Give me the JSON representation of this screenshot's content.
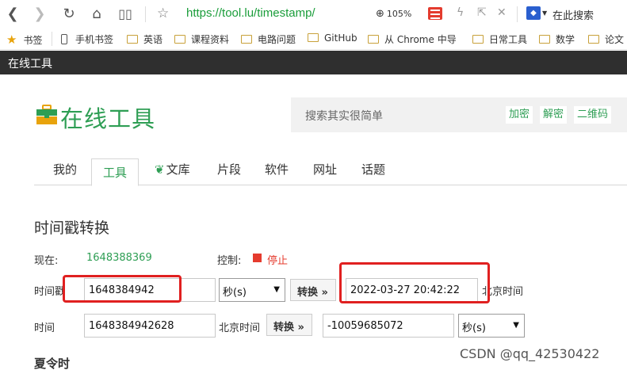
{
  "browser": {
    "url_scheme": "https://",
    "url_rest": "tool.lu/timestamp/",
    "zoom": "105%",
    "search_here": "在此搜索"
  },
  "bookmarks": [
    {
      "label": "书签",
      "icon": "star-icon"
    },
    {
      "label": "手机书签",
      "icon": "phone-icon"
    },
    {
      "label": "英语",
      "icon": "folder-icon"
    },
    {
      "label": "课程资料",
      "icon": "folder-icon"
    },
    {
      "label": "电路问题",
      "icon": "folder-icon"
    },
    {
      "label": "GitHub",
      "icon": "folder-icon"
    },
    {
      "label": "从 Chrome 中导",
      "icon": "folder-icon"
    },
    {
      "label": "日常工具",
      "icon": "folder-icon"
    },
    {
      "label": "数学",
      "icon": "folder-icon"
    },
    {
      "label": "论文",
      "icon": "folder-icon"
    }
  ],
  "sitebar_title": "在线工具",
  "logo_text": "在线工具",
  "search": {
    "placeholder": "搜索其实很简单",
    "buttons": [
      "加密",
      "解密",
      "二维码"
    ]
  },
  "tabs": [
    "我的",
    "工具",
    "文库",
    "片段",
    "软件",
    "网址",
    "话题"
  ],
  "active_tab": "工具",
  "section_title": "时间戳转换",
  "now": {
    "label": "现在:",
    "value": "1648388369"
  },
  "control": {
    "label": "控制:",
    "stop": "停止"
  },
  "row1": {
    "label": "时间戳",
    "input": "1648384942",
    "unit": "秒(s)",
    "button": "转换 »",
    "result": "2022-03-27 20:42:22",
    "tz": "北京时间"
  },
  "row2": {
    "label": "时间",
    "input": "1648384942628",
    "tz": "北京时间",
    "button": "转换 »",
    "result": "-10059685072",
    "unit": "秒(s)"
  },
  "subhead": "夏令时",
  "watermark": "CSDN @qq_42530422"
}
